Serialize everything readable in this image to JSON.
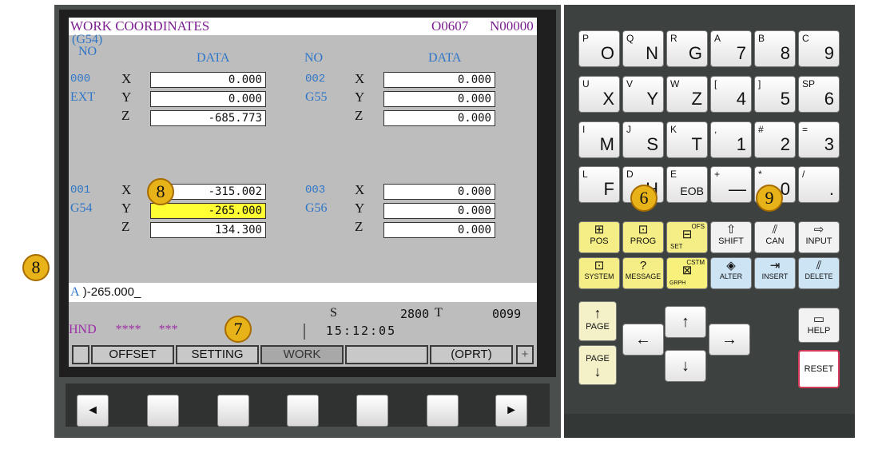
{
  "header": {
    "title": "WORK COORDINATES",
    "program": "O0607",
    "seq": "N00000"
  },
  "table": {
    "g54_top": "(G54)",
    "no_left": "NO",
    "data_left": "DATA",
    "no_right": "NO",
    "data_right": "DATA",
    "rows_left": [
      {
        "code": "000",
        "axis": "X",
        "value": "0.000"
      },
      {
        "code": "EXT",
        "axis": "Y",
        "value": "0.000"
      },
      {
        "code": "",
        "axis": "Z",
        "value": "-685.773"
      },
      {
        "code": "001",
        "axis": "X",
        "value": "-315.002"
      },
      {
        "code": "G54",
        "axis": "Y",
        "value": "-265.000"
      },
      {
        "code": "",
        "axis": "Z",
        "value": "134.300"
      }
    ],
    "rows_right": [
      {
        "code": "002",
        "axis": "X",
        "value": "0.000"
      },
      {
        "code": "G55",
        "axis": "Y",
        "value": "0.000"
      },
      {
        "code": "",
        "axis": "Z",
        "value": "0.000"
      },
      {
        "code": "003",
        "axis": "X",
        "value": "0.000"
      },
      {
        "code": "G56",
        "axis": "Y",
        "value": "0.000"
      },
      {
        "code": "",
        "axis": "Z",
        "value": "0.000"
      }
    ]
  },
  "input": {
    "prefix": "A",
    "text": ")-265.000_"
  },
  "status": {
    "s_label": "S",
    "s_value": "2800",
    "t_label": "T",
    "t_value": "0099",
    "mode": "HND",
    "stars1": "****",
    "stars2": "***",
    "clock": "15:12:05"
  },
  "softkeys": [
    "OFFSET",
    "SETTING",
    "WORK",
    "",
    "(OPRT)",
    "+"
  ],
  "fkeys": {
    "left": "◄",
    "right": "►"
  },
  "keypad": {
    "row1": [
      {
        "sup": "P",
        "main": "O"
      },
      {
        "sup": "Q",
        "main": "N"
      },
      {
        "sup": "R",
        "main": "G"
      },
      {
        "sup": "A",
        "main": "7"
      },
      {
        "sup": "B",
        "main": "8"
      },
      {
        "sup": "C",
        "main": "9"
      }
    ],
    "row2": [
      {
        "sup": "U",
        "main": "X"
      },
      {
        "sup": "V",
        "main": "Y"
      },
      {
        "sup": "W",
        "main": "Z"
      },
      {
        "sup": "[",
        "main": "4"
      },
      {
        "sup": "]",
        "main": "5"
      },
      {
        "sup": "SP",
        "main": "6"
      }
    ],
    "row3": [
      {
        "sup": "I",
        "main": "M"
      },
      {
        "sup": "J",
        "main": "S"
      },
      {
        "sup": "K",
        "main": "T"
      },
      {
        "sup": ",",
        "main": "1"
      },
      {
        "sup": "#",
        "main": "2"
      },
      {
        "sup": "=",
        "main": "3"
      }
    ],
    "row4": [
      {
        "sup": "L",
        "main": "F"
      },
      {
        "sup": "D",
        "main": "H"
      },
      {
        "sup": "E",
        "main": "EOB"
      },
      {
        "sup": "+",
        "main": "—"
      },
      {
        "sup": "*",
        "main": "0"
      },
      {
        "sup": "/",
        "main": "."
      }
    ],
    "fn1": [
      "POS",
      "PROG",
      "SET",
      "SHIFT",
      "CAN",
      "INPUT"
    ],
    "fn2": [
      "SYSTEM",
      "MESSAGE",
      "GRPH",
      "ALTER",
      "INSERT",
      "DELETE"
    ],
    "ofs": "OFS",
    "cstm": "CSTM",
    "page_up": "PAGE",
    "page_down": "PAGE",
    "help": "HELP",
    "reset": "RESET"
  },
  "badges": [
    "8",
    "8",
    "7",
    "6",
    "9"
  ]
}
